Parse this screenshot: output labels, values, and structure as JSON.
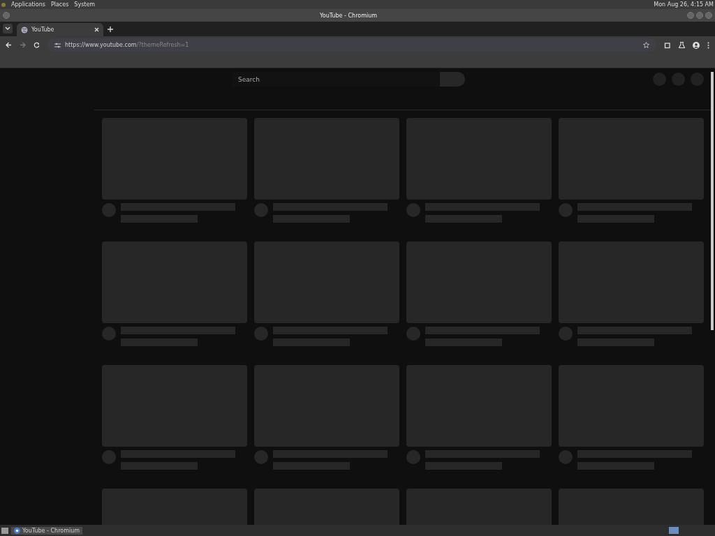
{
  "top_panel": {
    "menus": [
      "Applications",
      "Places",
      "System"
    ],
    "clock": "Mon Aug 26, 4:15 AM"
  },
  "window": {
    "title": "YouTube - Chromium"
  },
  "tabs": [
    {
      "label": "YouTube",
      "selected": true
    }
  ],
  "address_bar": {
    "url_host": "https://www.youtube.com",
    "url_rest": "/?themeRefresh=1"
  },
  "page": {
    "search": {
      "placeholder": "Search"
    }
  },
  "taskbar": {
    "items": [
      {
        "label": "YouTube - Chromium",
        "selected": true
      }
    ]
  }
}
